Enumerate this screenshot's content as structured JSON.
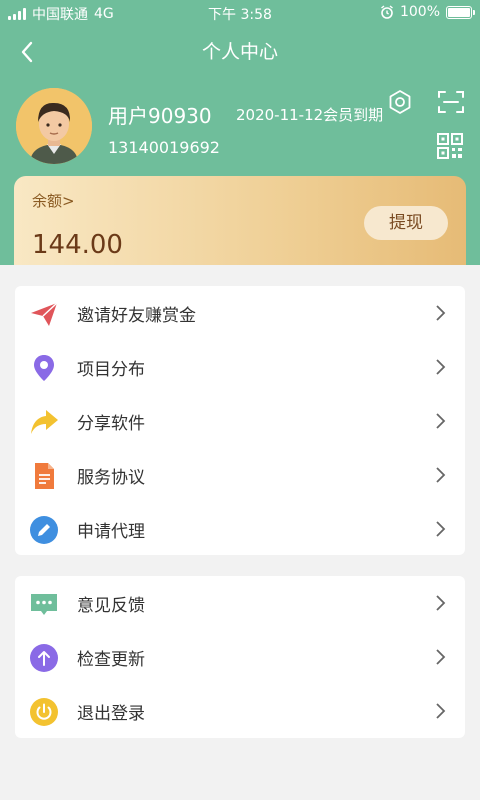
{
  "status_bar": {
    "carrier": "中国联通",
    "network": "4G",
    "time": "下午 3:58",
    "battery": "100%"
  },
  "nav": {
    "title": "个人中心"
  },
  "profile": {
    "username": "用户90930",
    "expiry": "2020-11-12会员到期",
    "phone": "13140019692"
  },
  "balance": {
    "label": "余额>",
    "value": "144.00",
    "withdraw_label": "提现"
  },
  "menu_group_1": [
    {
      "label": "邀请好友赚赏金",
      "icon": "paper-plane-icon",
      "color": "#e0555a"
    },
    {
      "label": "项目分布",
      "icon": "location-pin-icon",
      "color": "#8a6ae6"
    },
    {
      "label": "分享软件",
      "icon": "share-arrow-icon",
      "color": "#f3c230"
    },
    {
      "label": "服务协议",
      "icon": "document-icon",
      "color": "#f07a3c"
    },
    {
      "label": "申请代理",
      "icon": "pencil-icon",
      "color": "#3f8fe0"
    }
  ],
  "menu_group_2": [
    {
      "label": "意见反馈",
      "icon": "chat-bubble-icon",
      "color": "#6fbe9b"
    },
    {
      "label": "检查更新",
      "icon": "upload-arrow-icon",
      "color": "#8a6ae6"
    },
    {
      "label": "退出登录",
      "icon": "power-icon",
      "color": "#f3c230"
    }
  ],
  "colors": {
    "header": "#6fbe9b",
    "page_bg": "#f2f2f2"
  }
}
